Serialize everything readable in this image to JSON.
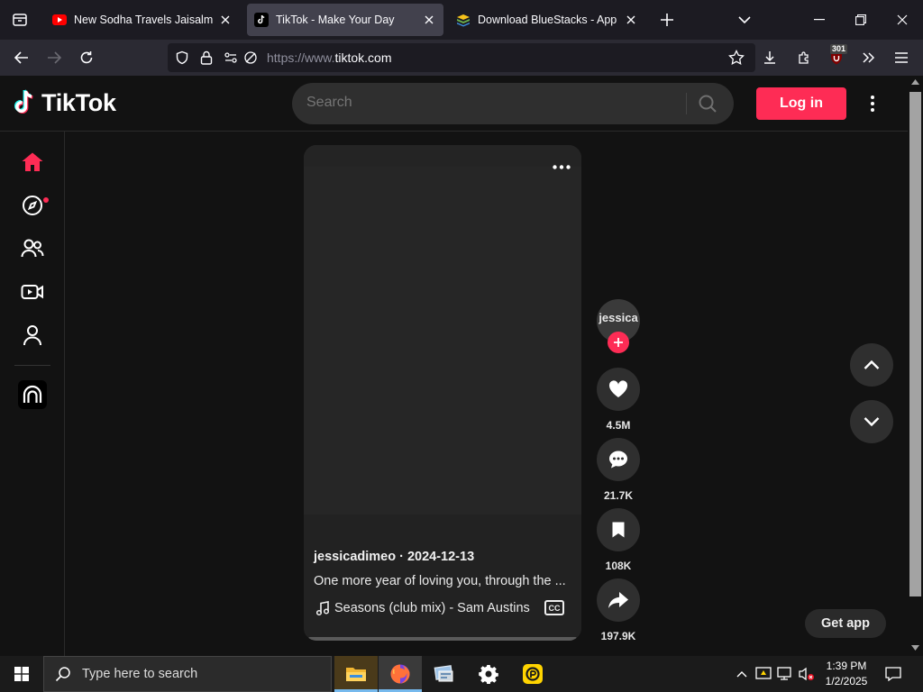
{
  "browser": {
    "tabs": [
      {
        "title": "New Sodha Travels Jaisalmer To",
        "active": false
      },
      {
        "title": "TikTok - Make Your Day",
        "active": true
      },
      {
        "title": "Download BlueStacks - App Pla",
        "active": false
      }
    ],
    "url_scheme": "https://www.",
    "url_host": "tiktok.com",
    "extension_badge": "301"
  },
  "tiktok": {
    "logo_text": "TikTok",
    "search_placeholder": "Search",
    "login_label": "Log in",
    "video": {
      "author": "jessicadimeo · 2024-12-13",
      "caption": "One more year of loving you, through the ...",
      "music": "Seasons (club mix) - Sam Austins",
      "cc_label": "CC",
      "avatar_text": "jessica"
    },
    "actions": {
      "likes": "4.5M",
      "comments": "21.7K",
      "saves": "108K",
      "shares": "197.9K"
    },
    "get_app_label": "Get app"
  },
  "taskbar": {
    "search_placeholder": "Type here to search",
    "time": "1:39 PM",
    "date": "1/2/2025"
  },
  "colors": {
    "accent": "#fe2c55",
    "page_bg": "#121212",
    "tab_active": "#42414d"
  }
}
